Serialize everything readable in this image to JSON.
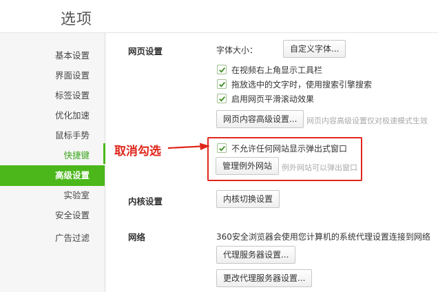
{
  "header": {
    "title": "选项"
  },
  "sidebar": {
    "items": [
      {
        "label": "基本设置"
      },
      {
        "label": "界面设置"
      },
      {
        "label": "标签设置"
      },
      {
        "label": "优化加速"
      },
      {
        "label": "鼠标手势"
      },
      {
        "label": "快捷键"
      },
      {
        "label": "高级设置"
      },
      {
        "label": "实验室"
      },
      {
        "label": "安全设置"
      },
      {
        "label": "广告过滤"
      }
    ],
    "active_index": 6
  },
  "web_settings": {
    "title": "网页设置",
    "font_size_label": "字体大小：",
    "custom_font_button": "自定义字体...",
    "checkboxes": [
      {
        "label": "在视频右上角显示工具栏",
        "checked": true
      },
      {
        "label": "拖放选中的文字时，使用搜索引擎搜索",
        "checked": true
      },
      {
        "label": "启用网页平滑滚动效果",
        "checked": true
      }
    ],
    "advanced_button": "网页内容高级设置...",
    "advanced_hint": "网页内容高级设置仅对极速模式生效",
    "popup_checkbox": {
      "label": "不允许任何网站显示弹出式窗口",
      "checked": true
    },
    "exceptions_button": "管理例外网站",
    "exceptions_hint": "例外网站可以弹出窗口"
  },
  "kernel_settings": {
    "title": "内核设置",
    "switch_button": "内核切换设置"
  },
  "network": {
    "title": "网络",
    "description": "360安全浏览器会使用您计算机的系统代理设置连接到网络",
    "proxy_button": "代理服务器设置...",
    "change_proxy_button": "更改代理服务器设置..."
  },
  "annotation": {
    "text": "取消勾选",
    "color": "#e0261b"
  },
  "colors": {
    "accent": "#4bb71b",
    "highlight": "#e0261b"
  }
}
